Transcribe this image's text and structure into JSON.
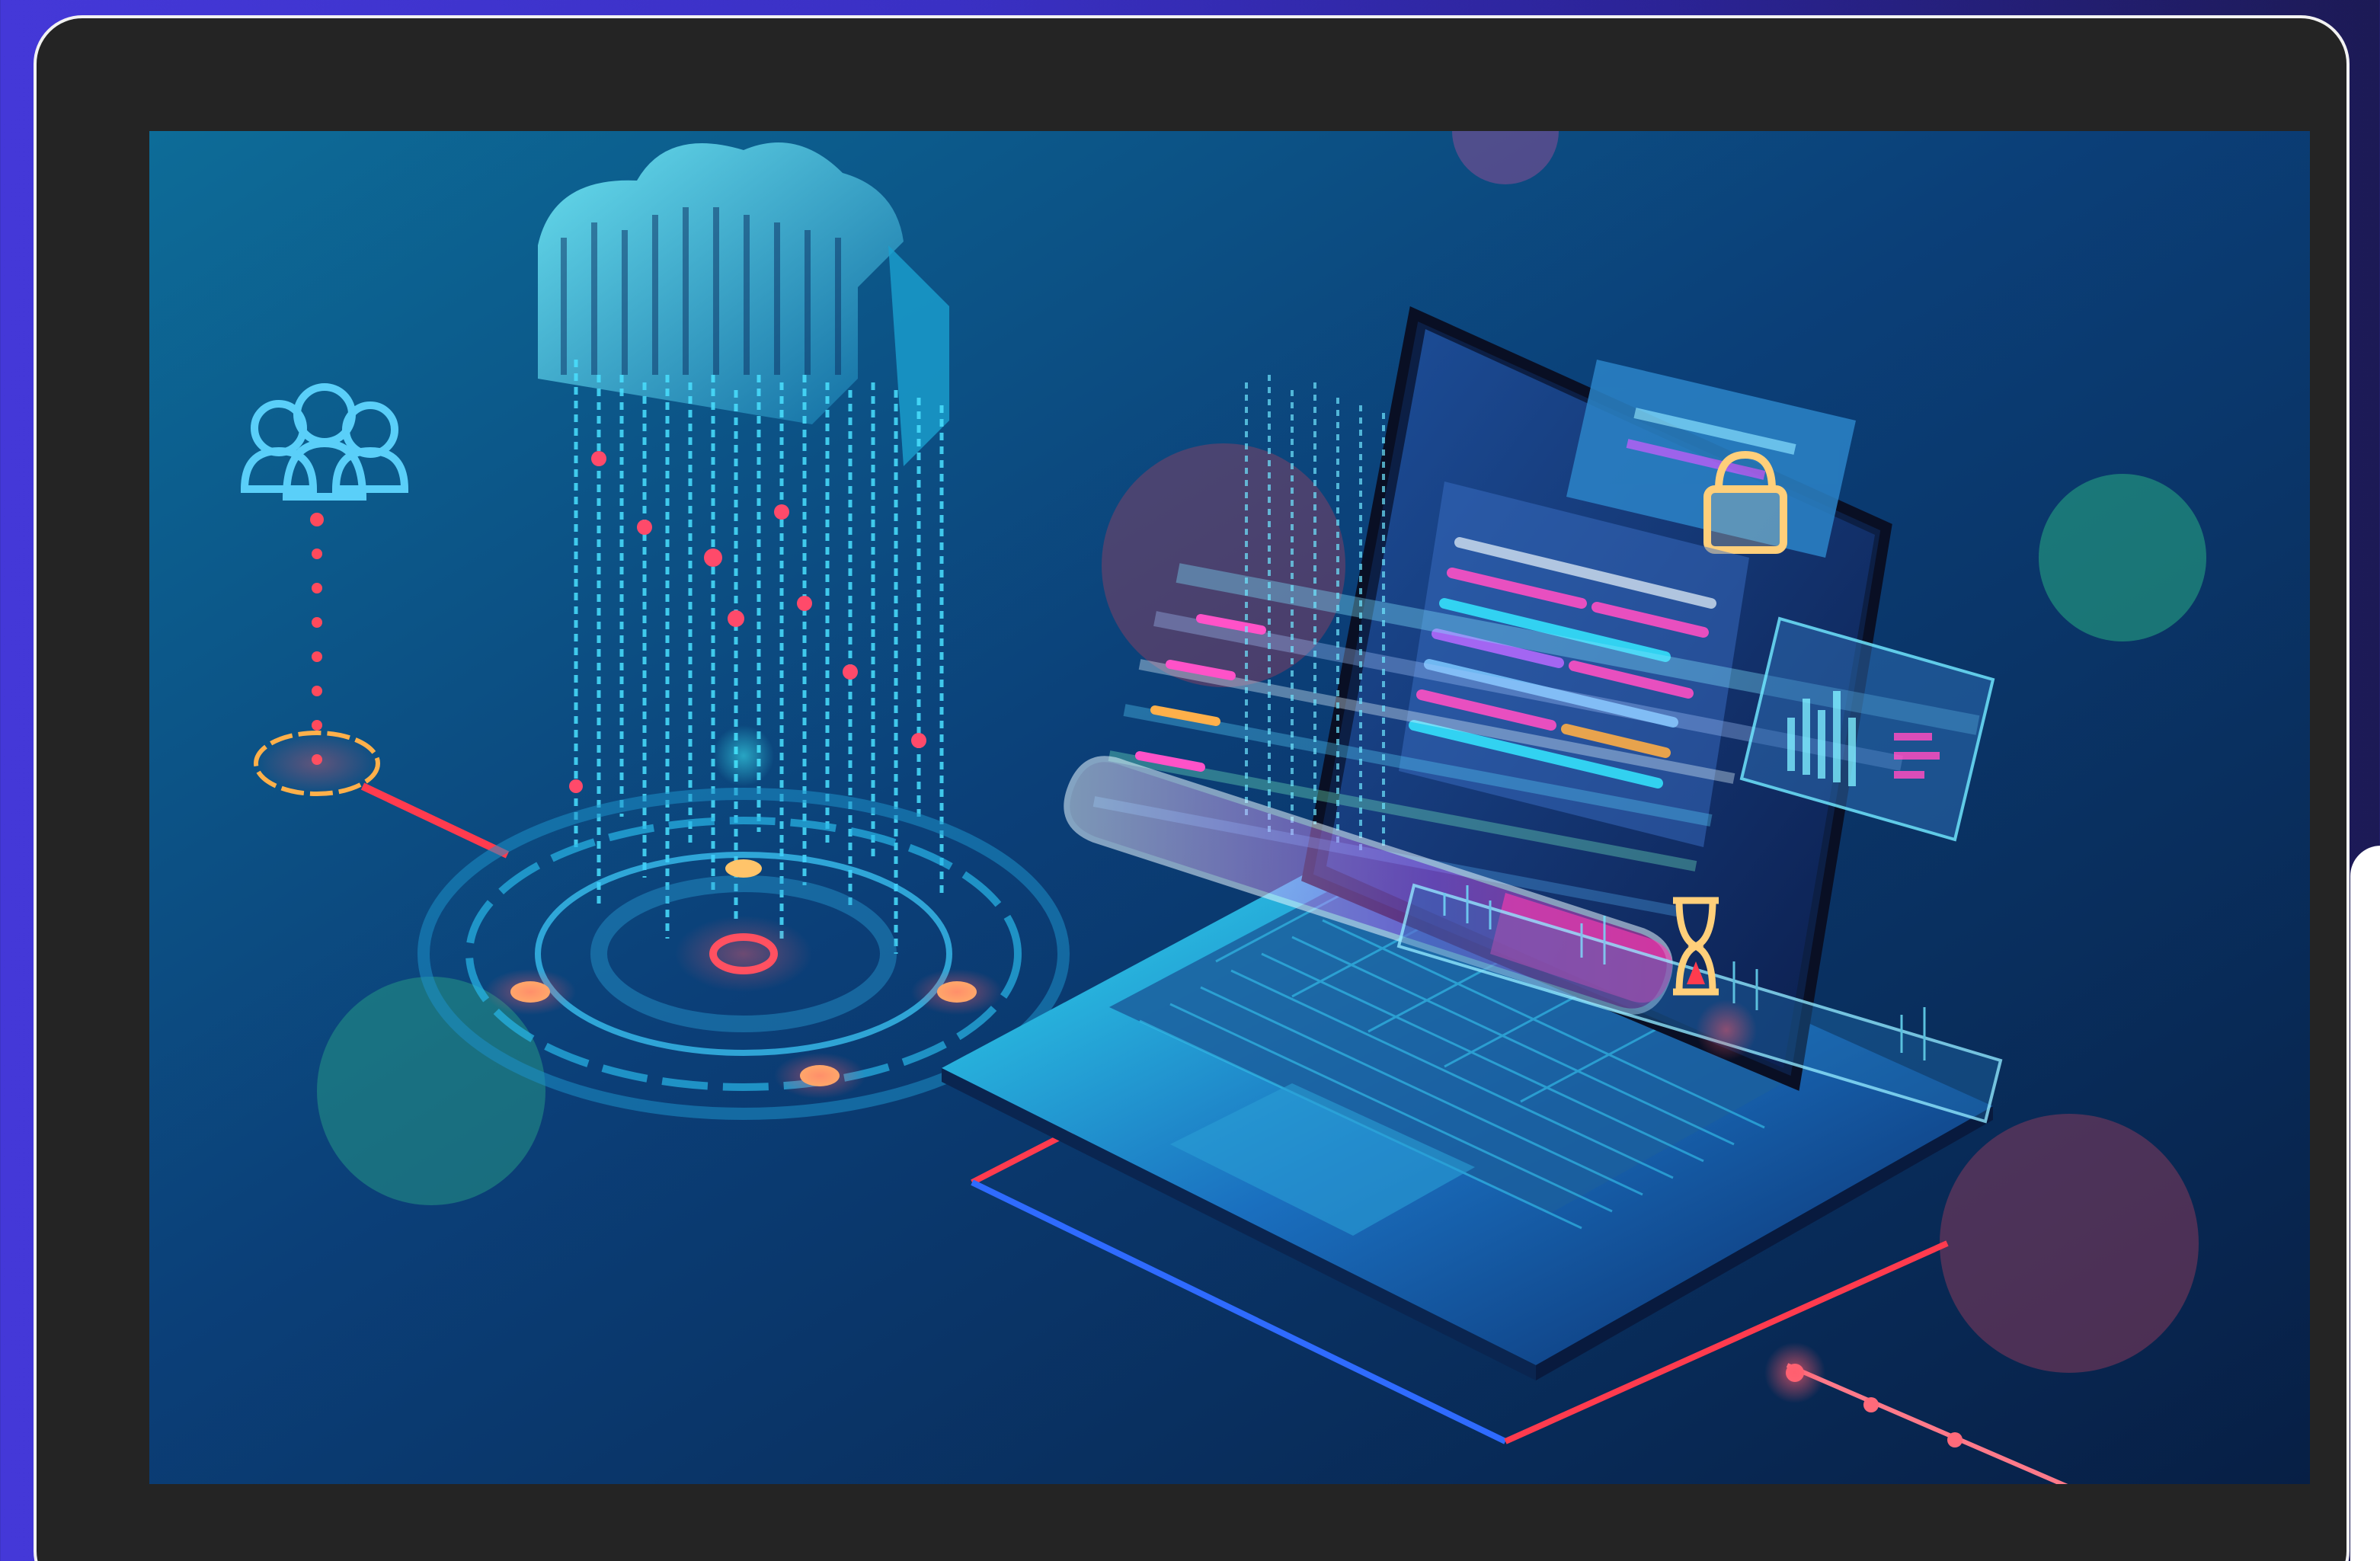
{
  "scene": {
    "description_free": true,
    "colors": {
      "outer_bg_left": "#4438d8",
      "outer_bg_right": "#1c1a55",
      "frame": "#242424",
      "frame_border": "#f2f2f2",
      "screen_bg_top": "#0b5e8a",
      "screen_bg_bottom": "#0a2450",
      "neon_cyan": "#2ff0ff",
      "neon_red": "#ff3b4e",
      "neon_pink": "#ff4fd8",
      "neon_orange": "#ffb04a"
    },
    "icons": [
      "users-icon",
      "cloud-icon",
      "lock-icon",
      "hourglass-icon",
      "laptop-icon",
      "target-ring-icon"
    ]
  }
}
